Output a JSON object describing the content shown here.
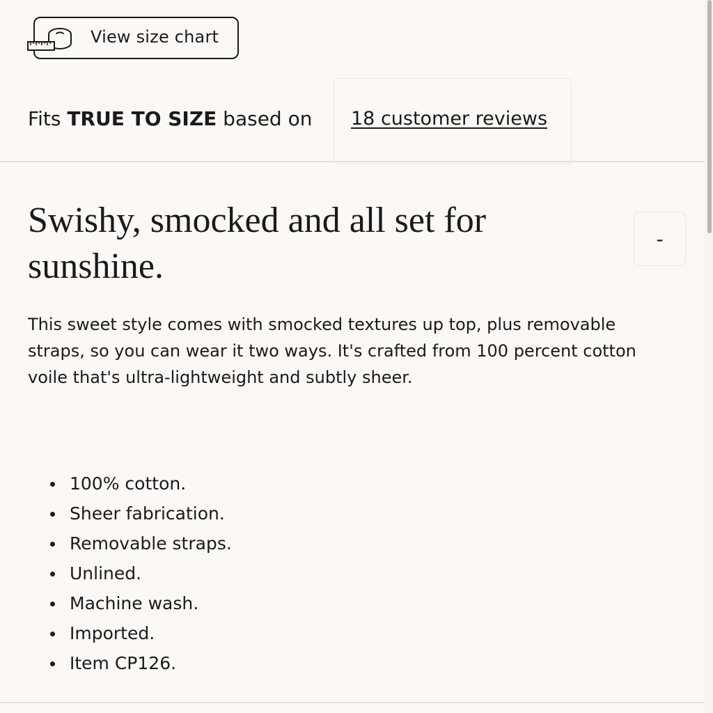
{
  "size_chart": {
    "label": "View size chart",
    "icon": "measuring-tape-icon"
  },
  "fit": {
    "prefix": "Fits",
    "verdict": "TRUE TO SIZE",
    "suffix": "based on",
    "reviews_link": "18 customer reviews"
  },
  "headline": "Swishy, smocked and all set for sunshine.",
  "collapse_button": "-",
  "description": "This sweet style comes with smocked textures up top, plus removable straps, so you can wear it two ways. It's crafted from 100 percent cotton voile that's ultra-lightweight and subtly sheer.",
  "features": [
    "100% cotton.",
    "Sheer fabrication.",
    "Removable straps.",
    "Unlined.",
    "Machine wash.",
    "Imported.",
    "Item CP126."
  ],
  "colors": {
    "background": "#fcf8f5",
    "text": "#1a1a1a",
    "divider": "#e4dfdb"
  }
}
